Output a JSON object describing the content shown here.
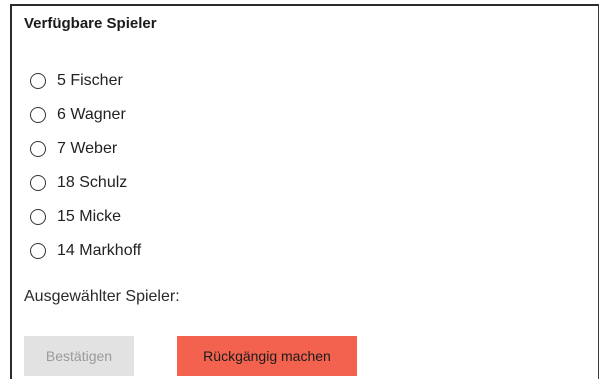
{
  "panel": {
    "title": "Verfügbare Spieler"
  },
  "players": [
    {
      "label": "5 Fischer",
      "selected": false
    },
    {
      "label": "6 Wagner",
      "selected": false
    },
    {
      "label": "7 Weber",
      "selected": false
    },
    {
      "label": "18 Schulz",
      "selected": false
    },
    {
      "label": "15 Micke",
      "selected": false
    },
    {
      "label": "14 Markhoff",
      "selected": false
    }
  ],
  "selection": {
    "label": "Ausgewählter Spieler:",
    "value": ""
  },
  "actions": {
    "confirm_label": "Bestätigen",
    "confirm_enabled": false,
    "undo_label": "Rückgängig machen"
  },
  "colors": {
    "undo_button": "#f2624f",
    "confirm_button_disabled": "#e2e2e2",
    "confirm_text_disabled": "#9a9a9a"
  }
}
